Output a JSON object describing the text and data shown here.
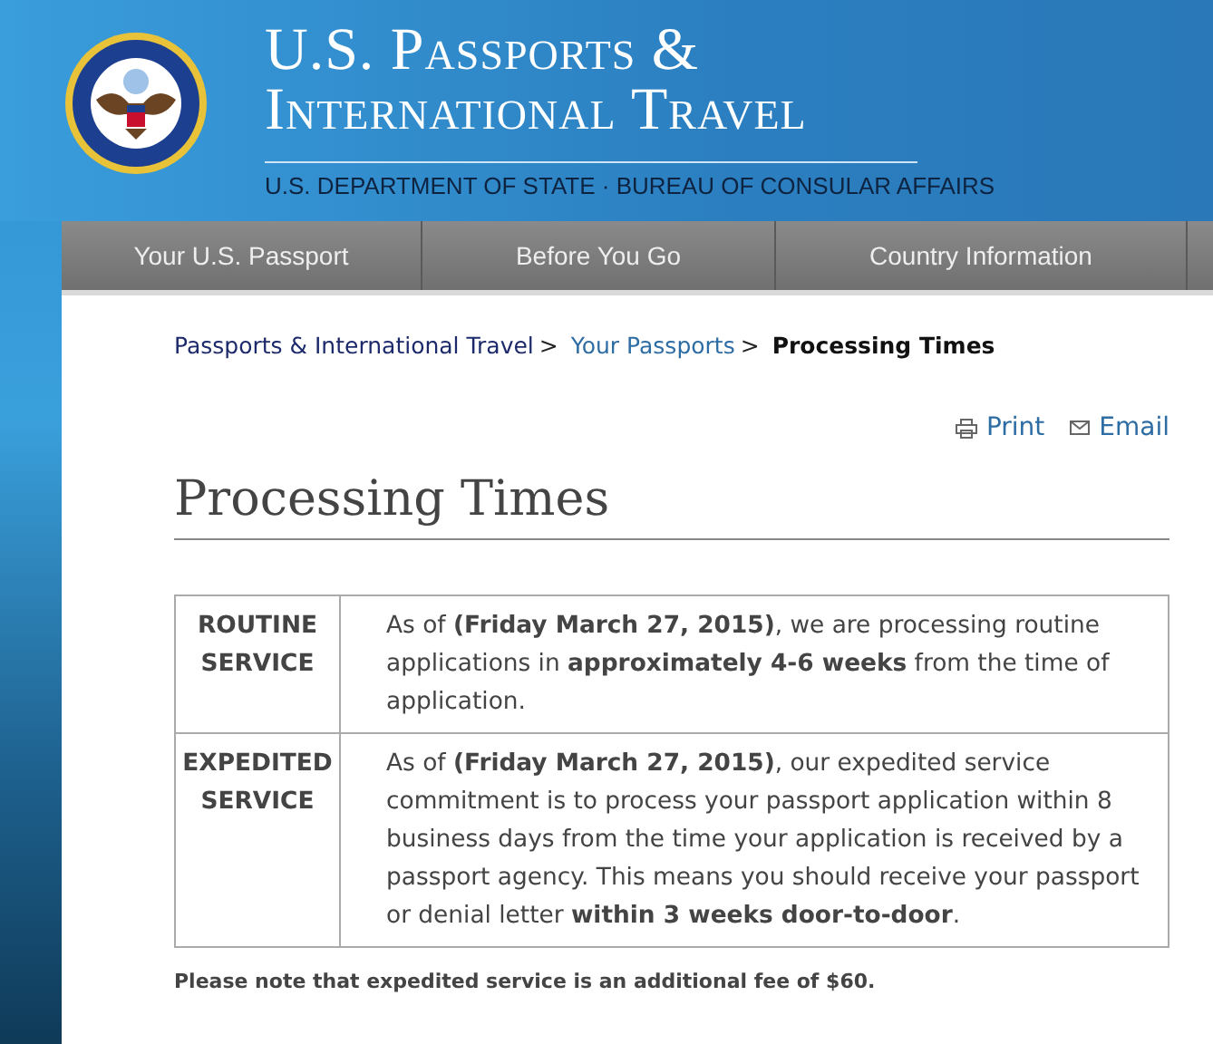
{
  "header": {
    "title_line_1": "U.S. Passports &",
    "title_line_2": "International Travel",
    "subtitle": "U.S. DEPARTMENT OF STATE · BUREAU OF CONSULAR AFFAIRS"
  },
  "nav": {
    "tabs": [
      {
        "label": "Your U.S. Passport"
      },
      {
        "label": "Before You Go"
      },
      {
        "label": "Country Information"
      }
    ]
  },
  "breadcrumb": [
    {
      "label": "Passports & International Travel",
      "kind": "link"
    },
    {
      "label": "Your Passports",
      "kind": "link"
    },
    {
      "label": "Processing Times",
      "kind": "current"
    }
  ],
  "breadcrumb_separator": ">",
  "actions": [
    {
      "label": "Print",
      "kind": "print"
    },
    {
      "label": "Email",
      "kind": "email"
    }
  ],
  "page_title": "Processing Times",
  "table": {
    "rows": [
      {
        "service": "ROUTINE SERVICE",
        "description": "As of **(Friday March 27, 2015)**, we are processing routine applications in **approximately 4-6 weeks** from the time of application."
      },
      {
        "service": "EXPEDITED SERVICE",
        "description": "As of **(Friday March 27, 2015)**, our expedited service commitment is to process your passport application within 8 business days from the time your application is received by a passport agency. This means you should receive your passport or denial letter **within 3 weeks door-to-door**."
      }
    ]
  },
  "note": "Please note that expedited service is an additional fee of $60."
}
